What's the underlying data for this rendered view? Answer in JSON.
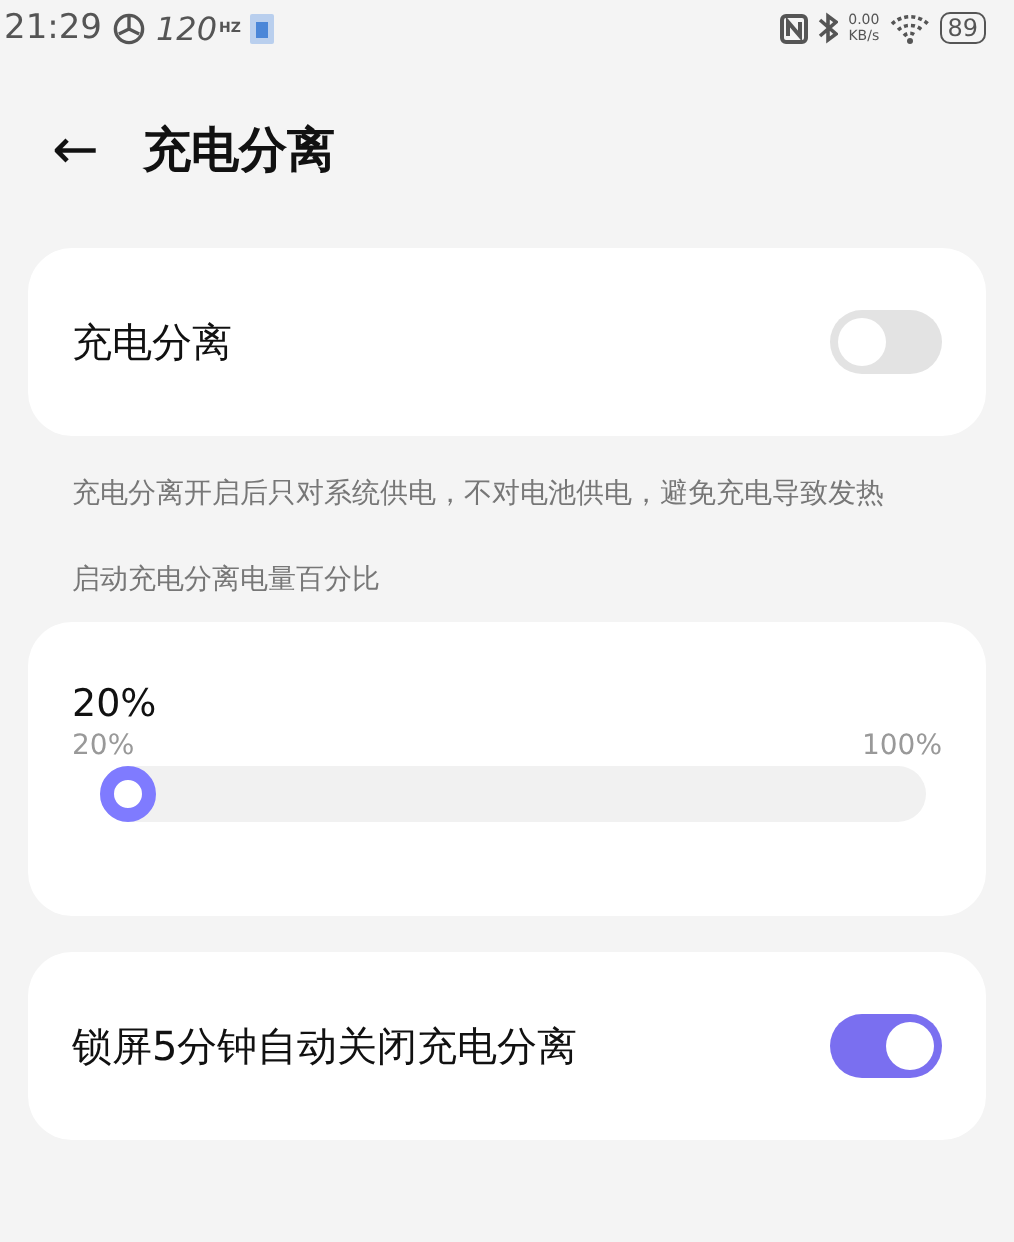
{
  "status_bar": {
    "time": "21:29",
    "refresh_rate": "120",
    "hz_unit": "HZ",
    "net_speed": "0.00",
    "net_unit": "KB/s",
    "battery": "89"
  },
  "header": {
    "back": "←",
    "title": "充电分离"
  },
  "toggle_card": {
    "label": "充电分离",
    "on": false
  },
  "description": "充电分离开启后只对系统供电，不对电池供电，避免充电导致发热",
  "section_label": "启动充电分离电量百分比",
  "slider_card": {
    "value": "20%",
    "min_label": "20%",
    "max_label": "100%",
    "level": 0
  },
  "lock_card": {
    "label": "锁屏5分钟自动关闭充电分离",
    "on": true
  }
}
